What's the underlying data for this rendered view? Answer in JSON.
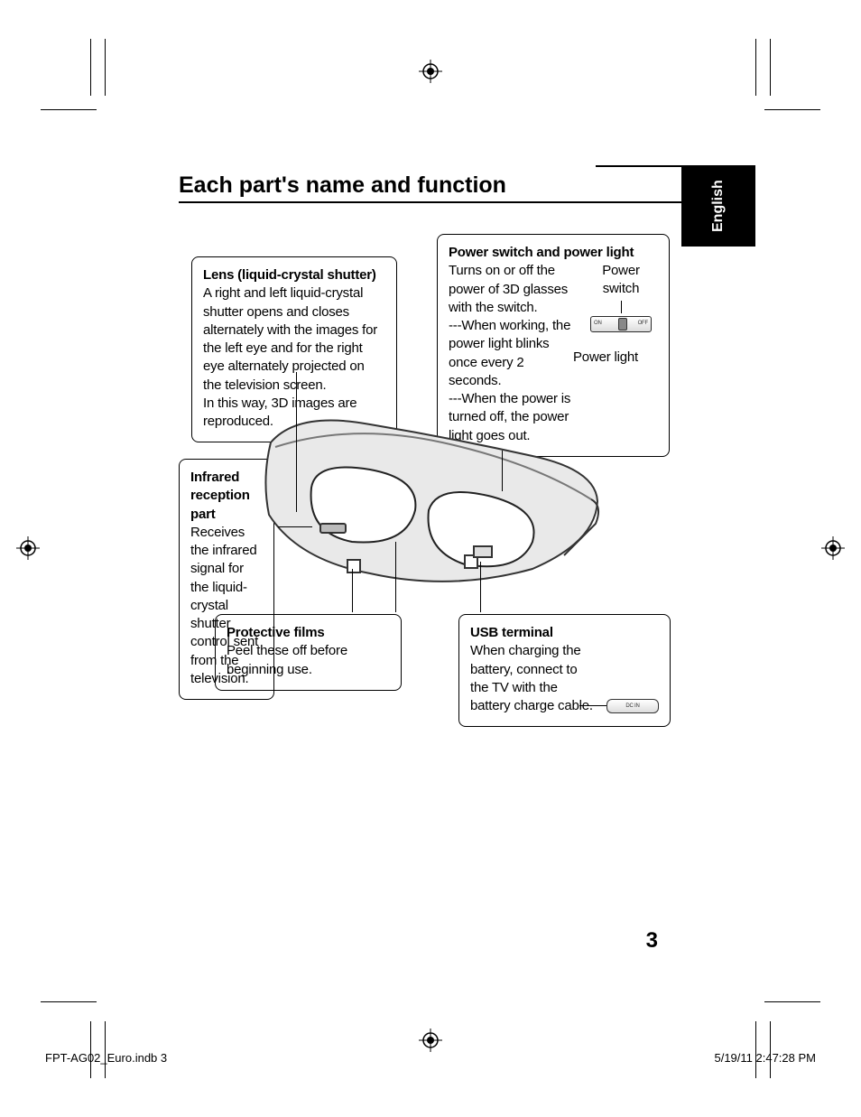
{
  "title": "Each part's name and function",
  "language_tab": "English",
  "callouts": {
    "lens": {
      "title": "Lens (liquid-crystal shutter)",
      "body": "A right and left liquid-crystal shutter opens and closes alternately with the images for the left eye and for the right eye alternately projected on the television screen.\nIn this way, 3D images are reproduced."
    },
    "power": {
      "title": "Power switch and power light",
      "body": "Turns on or off the power of 3D glasses with the switch.\n---When working, the power light blinks once every 2 seconds.\n---When the power is turned off, the power light goes out."
    },
    "power_labels": {
      "switch": "Power switch",
      "light": "Power light",
      "on": "ON",
      "off": "OFF"
    },
    "ir": {
      "title": "Infrared reception part",
      "body": "Receives the infrared signal for the liquid-crystal shutter control sent from the television."
    },
    "film": {
      "title": "Protective films",
      "body": "Peel these off before beginning use."
    },
    "usb": {
      "title": "USB terminal",
      "body": "When charging the battery, connect to the TV with the battery charge cable.",
      "port_label": "DC IN"
    }
  },
  "page_number": "3",
  "footer": {
    "file": "FPT-AG02_Euro.indb   3",
    "timestamp": "5/19/11   2:47:28 PM"
  }
}
